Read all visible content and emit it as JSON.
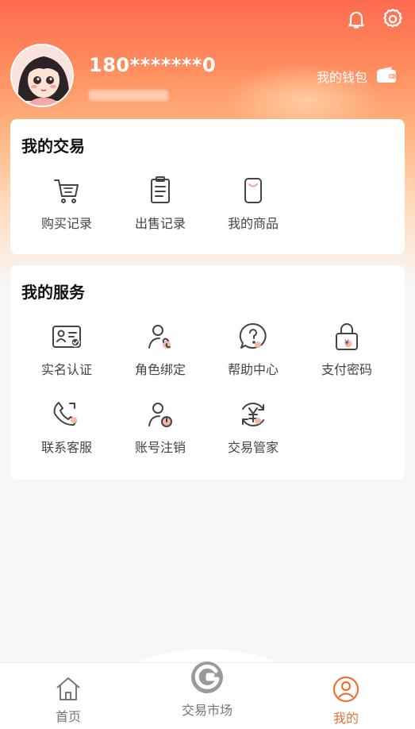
{
  "header": {
    "phone": "180*******0",
    "wallet_label": "我的钱包",
    "icons": [
      "bell-icon",
      "gear-icon",
      "wallet-icon"
    ]
  },
  "trade": {
    "title": "我的交易",
    "items": [
      {
        "label": "购买记录",
        "icon": "cart-icon"
      },
      {
        "label": "出售记录",
        "icon": "clipboard-icon"
      },
      {
        "label": "我的商品",
        "icon": "bag-icon"
      }
    ]
  },
  "service": {
    "title": "我的服务",
    "items": [
      {
        "label": "实名认证",
        "icon": "id-card-icon"
      },
      {
        "label": "角色绑定",
        "icon": "user-link-icon"
      },
      {
        "label": "帮助中心",
        "icon": "help-icon"
      },
      {
        "label": "支付密码",
        "icon": "lock-icon"
      },
      {
        "label": "联系客服",
        "icon": "phone-icon"
      },
      {
        "label": "账号注销",
        "icon": "user-power-icon"
      },
      {
        "label": "交易管家",
        "icon": "yuan-cycle-icon"
      }
    ]
  },
  "nav": {
    "items": [
      {
        "label": "首页",
        "icon": "home-icon"
      },
      {
        "label": "交易市场",
        "icon": "logo-g-icon"
      },
      {
        "label": "我的",
        "icon": "user-circle-icon"
      }
    ],
    "active": "我的"
  },
  "colors": {
    "accent": "#e8733a",
    "header_top": "#ff6b4f",
    "icon_stroke": "#444444",
    "icon_dot": "#f4b9a3"
  }
}
